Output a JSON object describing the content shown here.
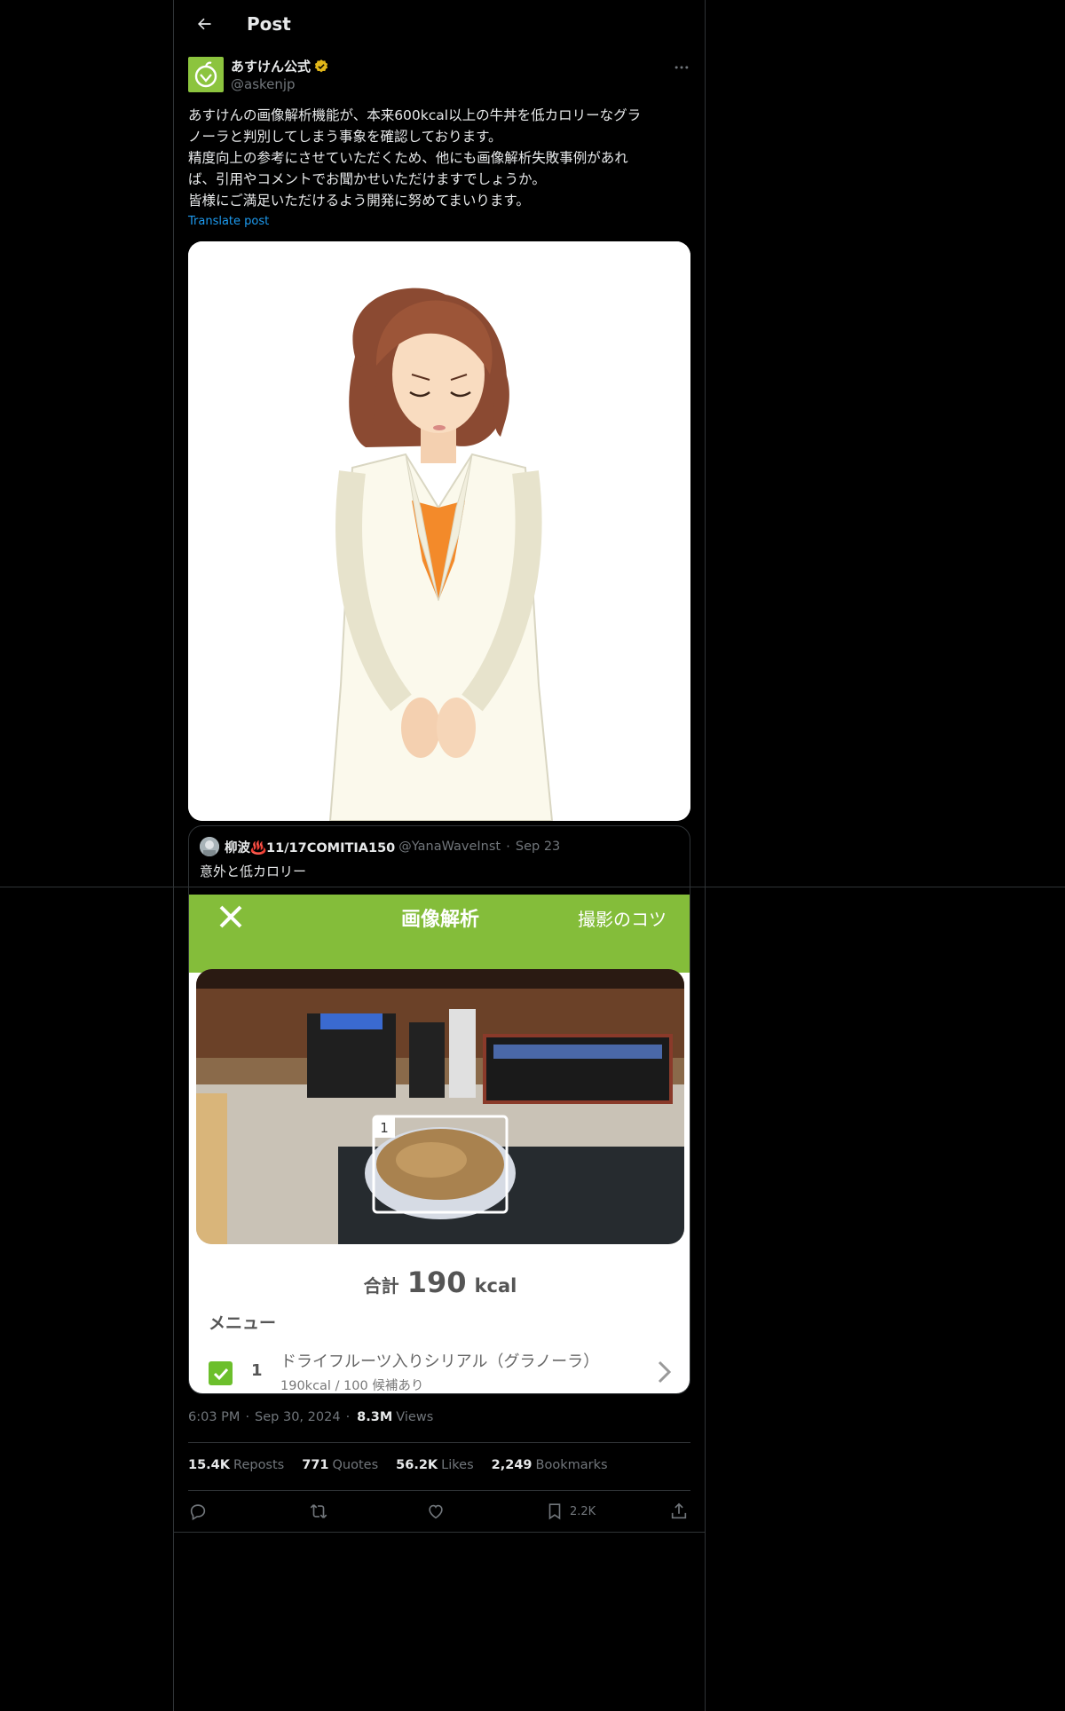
{
  "header": {
    "title": "Post"
  },
  "author": {
    "name": "あすけん公式",
    "handle": "@askenjp"
  },
  "post": {
    "text": "あすけんの画像解析機能が、本来600kcal以上の牛丼を低カロリーなグラ\nノーラと判別してしまう事象を確認しております。\n精度向上の参考にさせていただくため、他にも画像解析失敗事例があれ\nば、引用やコメントでお聞かせいただけますでしょうか。\n皆様にご満足いただけるよう開発に努めてまいります。",
    "translate_label": "Translate post"
  },
  "quote": {
    "name": "柳波♨️11/17COMITIA150",
    "handle": "@YanaWaveInst",
    "date": "Sep 23",
    "text": "意外と低カロリー",
    "app": {
      "title": "画像解析",
      "tips_label": "撮影のコツ",
      "photo_marker": "1",
      "total_label": "合計",
      "total_value": "190",
      "total_unit": "kcal",
      "menu_title": "メニュー",
      "item_number": "1",
      "item_name": "ドライフルーツ入りシリアル（グラノーラ）",
      "item_sub": "190kcal / 100 候補あり"
    }
  },
  "meta": {
    "time": "6:03 PM",
    "date": "Sep 30, 2024",
    "views_count": "8.3M",
    "views_label": "Views"
  },
  "stats": {
    "reposts_count": "15.4K",
    "reposts_label": "Reposts",
    "quotes_count": "771",
    "quotes_label": "Quotes",
    "likes_count": "56.2K",
    "likes_label": "Likes",
    "bookmarks_count": "2,249",
    "bookmarks_label": "Bookmarks"
  },
  "actions": {
    "bookmark_count": "2.2K"
  },
  "colors": {
    "background": "#000000",
    "text": "#e7e9ea",
    "muted": "#71767b",
    "link": "#1d9bf0",
    "border": "#2f3336",
    "verified": "#e2b719",
    "app_green": "#84bd3a"
  },
  "icons": [
    "back-arrow-icon",
    "verified-badge-icon",
    "more-icon",
    "close-icon",
    "checkbox-icon",
    "chevron-right-icon",
    "reply-icon",
    "repost-icon",
    "like-icon",
    "bookmark-icon",
    "share-icon"
  ]
}
